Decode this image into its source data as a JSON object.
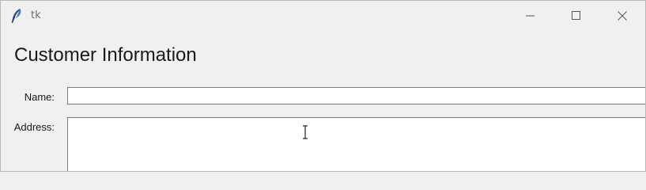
{
  "window": {
    "title": "tk",
    "icon": "feather-icon",
    "controls": {
      "minimize": "minimize-icon",
      "maximize": "maximize-icon",
      "close": "close-icon"
    }
  },
  "form": {
    "heading": "Customer Information",
    "name_label": "Name:",
    "name_value": "",
    "address_label": "Address:",
    "address_value": ""
  },
  "cursor": "text-ibeam-cursor"
}
